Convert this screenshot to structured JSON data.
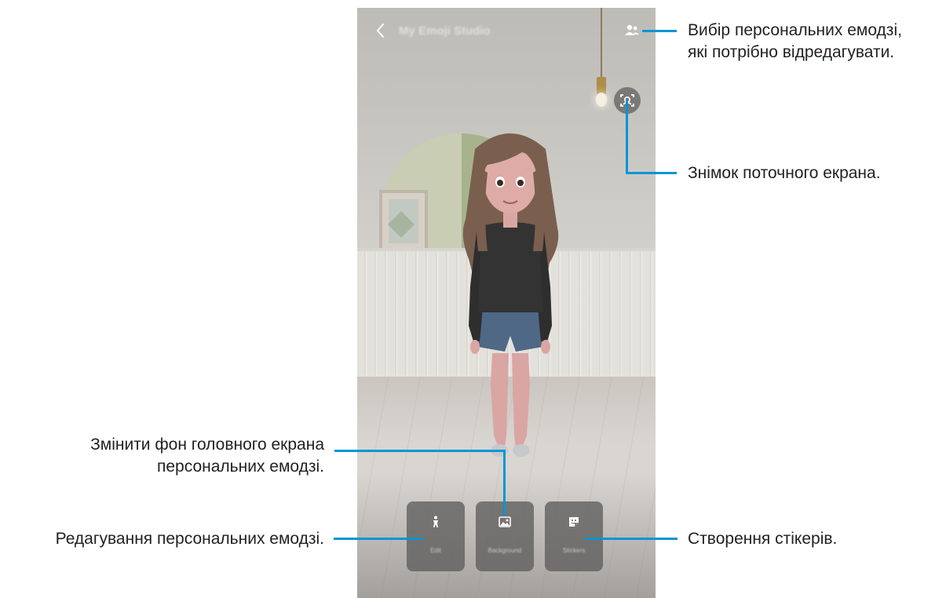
{
  "app_bar": {
    "back_icon": "chevron-left-icon",
    "title": "My Emoji Studio",
    "select_icon": "people-icon"
  },
  "snapshot": {
    "icon": "face-scan-camera-icon"
  },
  "actions": [
    {
      "icon": "person-icon",
      "label": "Edit"
    },
    {
      "icon": "image-icon",
      "label": "Background"
    },
    {
      "icon": "sticker-icon",
      "label": "Stickers"
    }
  ],
  "annotations": {
    "select_emoji": [
      "Вибір персональних емодзі,",
      "які потрібно відредагувати."
    ],
    "snapshot": "Знімок поточного екрана.",
    "change_bg": [
      "Змінити фон головного екрана",
      "персональних емодзі."
    ],
    "edit_emoji": "Редагування персональних емодзі.",
    "create_stickers": "Створення стікерів."
  },
  "colors": {
    "callout_line": "#0096d6",
    "action_button_bg": "#5f5d5c",
    "text": "#231f20"
  }
}
